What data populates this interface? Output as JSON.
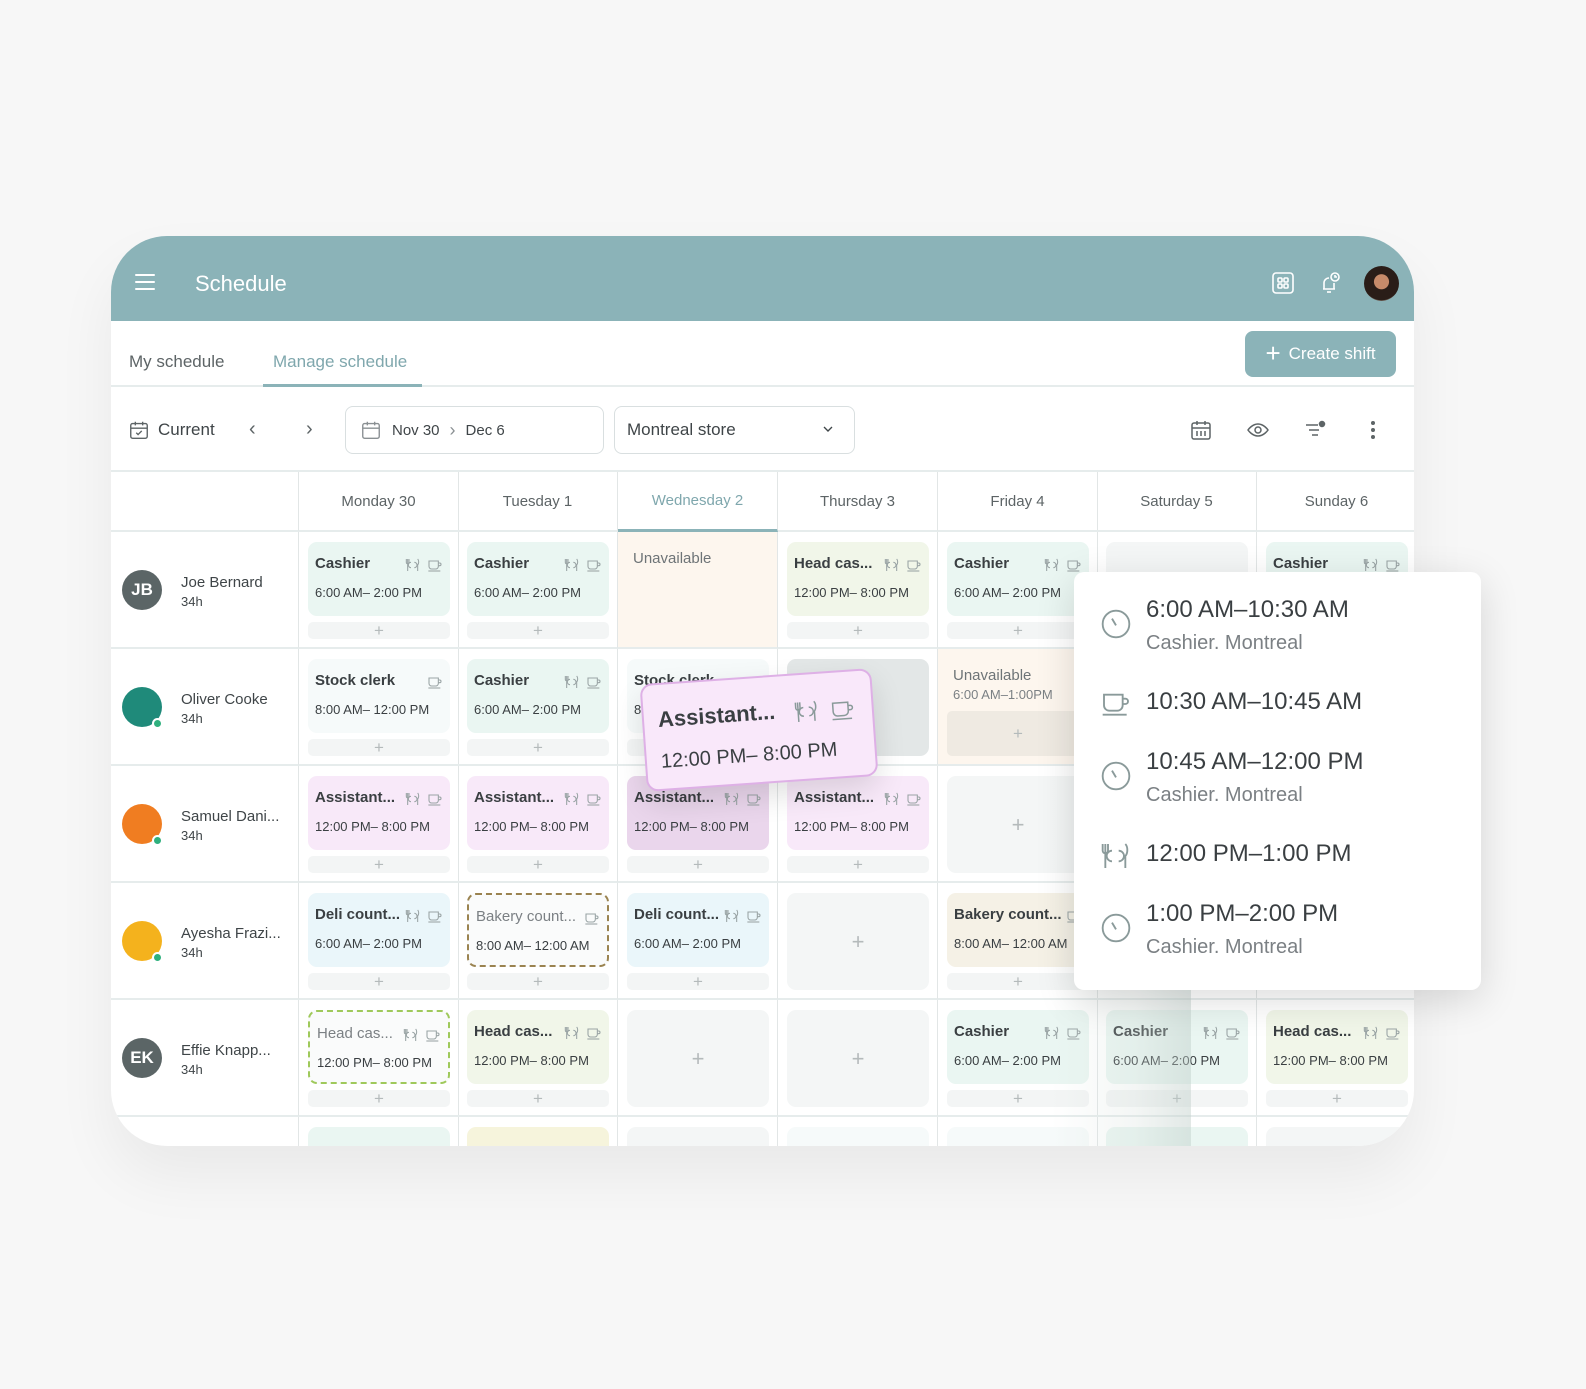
{
  "header": {
    "title": "Schedule",
    "icons": [
      "menu-icon",
      "apps-grid-icon",
      "bell-clock-icon",
      "user-avatar"
    ]
  },
  "tabs": [
    {
      "label": "My schedule",
      "active": false
    },
    {
      "label": "Manage schedule",
      "active": true
    }
  ],
  "create_button": {
    "label": "Create shift",
    "icon": "plus-icon"
  },
  "toolbar": {
    "current_label": "Current",
    "date_start": "Nov 30",
    "date_end": "Dec 6",
    "store": "Montreal store",
    "icons": [
      "calendar-view-icon",
      "eye-icon",
      "filter-icon",
      "more-vertical-icon"
    ]
  },
  "days": [
    {
      "label": "Monday 30",
      "today": false
    },
    {
      "label": "Tuesday 1",
      "today": false
    },
    {
      "label": "Wednesday 2",
      "today": true
    },
    {
      "label": "Thursday 3",
      "today": false
    },
    {
      "label": "Friday 4",
      "today": false
    },
    {
      "label": "Saturday 5",
      "today": false
    },
    {
      "label": "Sunday 6",
      "today": false
    }
  ],
  "employees": [
    {
      "initials": "JB",
      "name": "Joe Bernard",
      "hours": "34h",
      "online": false
    },
    {
      "initials": "",
      "name": "Oliver Cooke",
      "hours": "34h",
      "online": true
    },
    {
      "initials": "",
      "name": "Samuel Dani...",
      "hours": "34h",
      "online": true
    },
    {
      "initials": "",
      "name": "Ayesha Frazi...",
      "hours": "34h",
      "online": true
    },
    {
      "initials": "EK",
      "name": "Effie Knapp...",
      "hours": "34h",
      "online": false
    }
  ],
  "shifts": {
    "r0": [
      {
        "role": "Cashier",
        "time": "6:00 AM– 2:00 PM",
        "color": "green",
        "meal": true,
        "break": true
      },
      {
        "role": "Cashier",
        "time": "6:00 AM– 2:00 PM",
        "color": "green",
        "meal": true,
        "break": true
      },
      {
        "type": "unavailable",
        "label": "Unavailable"
      },
      {
        "role": "Head cas...",
        "time": "12:00 PM– 8:00 PM",
        "color": "lime",
        "meal": true,
        "break": true
      },
      {
        "role": "Cashier",
        "time": "6:00 AM– 2:00 PM",
        "color": "green",
        "meal": true,
        "break": true
      },
      {
        "type": "empty"
      },
      {
        "role": "Cashier",
        "time": "",
        "color": "green",
        "meal": true,
        "break": true
      }
    ],
    "r1": [
      {
        "role": "Stock clerk",
        "time": "8:00 AM– 12:00 PM",
        "color": "white",
        "meal": false,
        "break": true
      },
      {
        "role": "Cashier",
        "time": "6:00 AM– 2:00 PM",
        "color": "green",
        "meal": true,
        "break": true
      },
      {
        "role": "Stock clerk",
        "time": "8:00 AM– 12:00 PM",
        "color": "white",
        "meal": false,
        "break": true
      },
      {
        "type": "drop-target"
      },
      {
        "type": "unavailable",
        "label": "Unavailable",
        "sub": "6:00 AM–1:00PM"
      }
    ],
    "r2": [
      {
        "role": "Assistant...",
        "time": "12:00 PM– 8:00 PM",
        "color": "pink",
        "meal": true,
        "break": true
      },
      {
        "role": "Assistant...",
        "time": "12:00 PM– 8:00 PM",
        "color": "pink",
        "meal": true,
        "break": true
      },
      {
        "role": "Assistant...",
        "time": "12:00 PM– 8:00 PM",
        "color": "pink-dim",
        "meal": true,
        "break": true
      },
      {
        "role": "Assistant...",
        "time": "12:00 PM– 8:00 PM",
        "color": "pink",
        "meal": true,
        "break": true
      },
      {
        "type": "empty"
      }
    ],
    "r3": [
      {
        "role": "Deli count...",
        "time": "6:00 AM– 2:00 PM",
        "color": "blue",
        "meal": true,
        "break": true
      },
      {
        "role": "Bakery count...",
        "time": "8:00 AM– 12:00 AM",
        "color": "dashed-brown",
        "meal": false,
        "break": true
      },
      {
        "role": "Deli count...",
        "time": "6:00 AM– 2:00 PM",
        "color": "blue",
        "meal": true,
        "break": true
      },
      {
        "type": "empty"
      },
      {
        "role": "Bakery count...",
        "time": "8:00 AM– 12:00 AM",
        "color": "beige",
        "meal": false,
        "break": true
      }
    ],
    "r4": [
      {
        "role": "Head cas...",
        "time": "12:00 PM– 8:00 PM",
        "color": "dashed-lime",
        "meal": true,
        "break": true
      },
      {
        "role": "Head cas...",
        "time": "12:00 PM– 8:00 PM",
        "color": "lime",
        "meal": true,
        "break": true
      },
      {
        "type": "empty"
      },
      {
        "type": "empty"
      },
      {
        "role": "Cashier",
        "time": "6:00 AM– 2:00 PM",
        "color": "green",
        "meal": true,
        "break": true
      },
      {
        "role": "Cashier",
        "time": "6:00 AM– 2:00 PM",
        "color": "green",
        "meal": true,
        "break": true
      },
      {
        "role": "Head cas...",
        "time": "12:00 PM– 8:00 PM",
        "color": "lime",
        "meal": true,
        "break": true
      }
    ]
  },
  "dragging_shift": {
    "role": "Assistant...",
    "time": "12:00 PM– 8:00 PM"
  },
  "shift_breakdown": [
    {
      "icon": "clock-icon",
      "time": "6:00 AM–10:30 AM",
      "detail": "Cashier. Montreal"
    },
    {
      "icon": "coffee-break-icon",
      "time": "10:30 AM–10:45 AM",
      "detail": ""
    },
    {
      "icon": "clock-icon",
      "time": "10:45 AM–12:00 PM",
      "detail": "Cashier. Montreal"
    },
    {
      "icon": "meal-break-icon",
      "time": "12:00 PM–1:00 PM",
      "detail": ""
    },
    {
      "icon": "clock-icon",
      "time": "1:00 PM–2:00 PM",
      "detail": "Cashier. Montreal"
    }
  ],
  "add_symbol": "+"
}
